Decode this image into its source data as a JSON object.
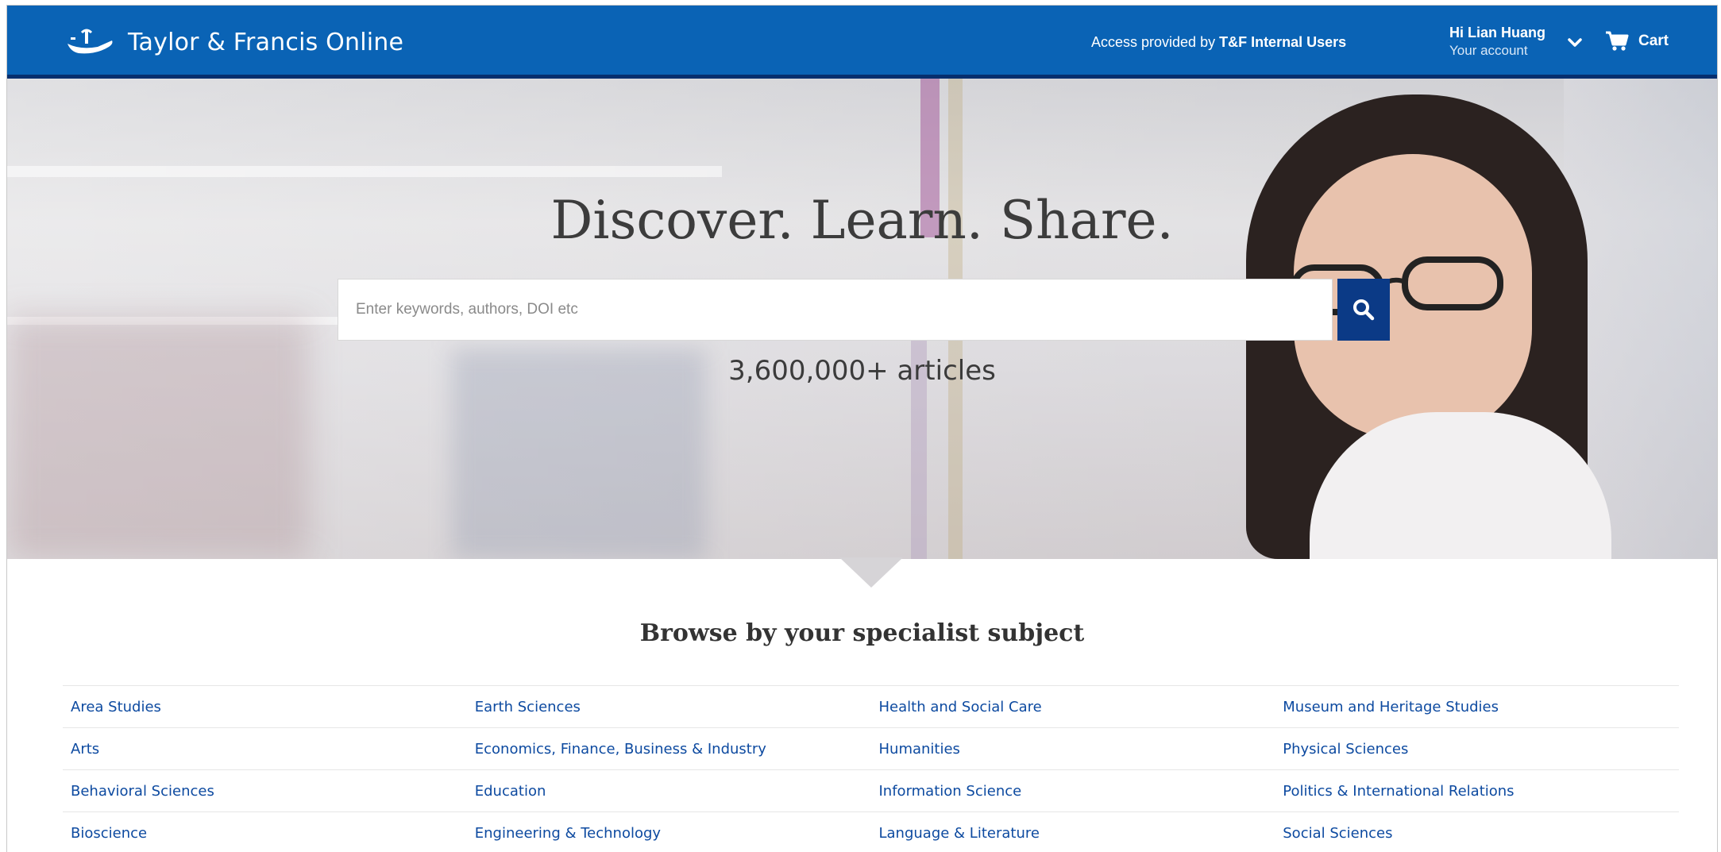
{
  "header": {
    "logo_text": "Taylor & Francis Online",
    "access_prefix": "Access provided by ",
    "access_org": "T&F Internal Users",
    "greeting": "Hi Lian Huang",
    "account_link": "Your account",
    "cart_label": "Cart",
    "bar_color": "#0a63b5"
  },
  "hero": {
    "title": "Discover. Learn. Share.",
    "search_placeholder": "Enter keywords, authors, DOI etc",
    "search_icon": "search-icon",
    "articles_count": "3,600,000+ articles",
    "search_button_color": "#0b3a86"
  },
  "browse": {
    "title": "Browse by your specialist subject",
    "rows": [
      [
        "Area Studies",
        "Earth Sciences",
        "Health and Social Care",
        "Museum and Heritage Studies"
      ],
      [
        "Arts",
        "Economics, Finance, Business & Industry",
        "Humanities",
        "Physical Sciences"
      ],
      [
        "Behavioral Sciences",
        "Education",
        "Information Science",
        "Politics & International Relations"
      ],
      [
        "Bioscience",
        "Engineering & Technology",
        "Language & Literature",
        "Social Sciences"
      ]
    ]
  }
}
